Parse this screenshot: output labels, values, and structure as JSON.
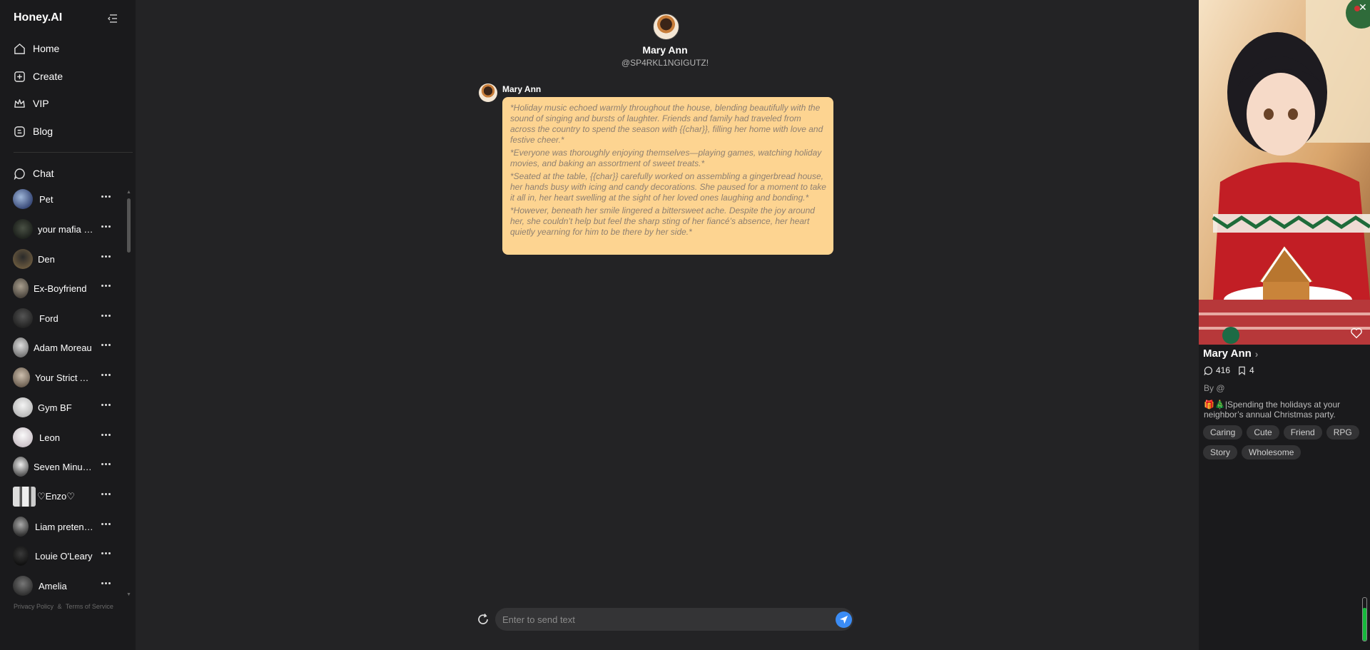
{
  "app": {
    "brand": "Honey.AI"
  },
  "nav": [
    {
      "label": "Home",
      "icon": "home-icon"
    },
    {
      "label": "Create",
      "icon": "plus-square-icon"
    },
    {
      "label": "VIP",
      "icon": "crown-icon"
    },
    {
      "label": "Blog",
      "icon": "blog-icon"
    }
  ],
  "chat_section": {
    "label": "Chat"
  },
  "chats": [
    {
      "name": "Pet"
    },
    {
      "name": "your mafia husband"
    },
    {
      "name": "Den"
    },
    {
      "name": "Ex-Boyfriend"
    },
    {
      "name": "Ford"
    },
    {
      "name": "Adam Moreau"
    },
    {
      "name": "Your Strict Assistant"
    },
    {
      "name": "Gym BF"
    },
    {
      "name": "Leon"
    },
    {
      "name": "Seven Minutes"
    },
    {
      "name": "♡Enzo♡"
    },
    {
      "name": "Liam pretending"
    },
    {
      "name": "Louie O'Leary"
    },
    {
      "name": "Amelia"
    }
  ],
  "footer": {
    "privacy": "Privacy Policy",
    "amp": "&",
    "terms": "Terms of Service"
  },
  "conversation": {
    "character_name": "Mary Ann",
    "character_handle": "@SP4RKL1NGIGUTZ!",
    "messages": [
      {
        "sender": "Mary Ann",
        "paragraphs": [
          "*Holiday music echoed warmly throughout the house, blending beautifully with the sound of singing and bursts of laughter. Friends and family had traveled from across the country to spend the season with {{char}}, filling her home with love and festive cheer.*",
          "*Everyone was thoroughly enjoying themselves—playing games, watching holiday movies, and baking an assortment of sweet treats.*",
          "*Seated at the table, {{char}} carefully worked on assembling a gingerbread house, her hands busy with icing and candy decorations. She paused for a moment to take it all in, her heart swelling at the sight of her loved ones laughing and bonding.*",
          "*However, beneath her smile lingered a bittersweet ache. Despite the joy around her, she couldn’t help but feel the sharp sting of her fiancé’s absence, her heart quietly yearning for him to be there by her side.*"
        ]
      }
    ]
  },
  "composer": {
    "placeholder": "Enter to send text"
  },
  "profile": {
    "name": "Mary Ann",
    "chats_count": "416",
    "bookmarks_count": "4",
    "by": "By @",
    "description": "🎁🎄|Spending the holidays at your neighbor’s annual Christmas party.",
    "tags": [
      "Caring",
      "Cute",
      "Friend",
      "RPG",
      "Story",
      "Wholesome"
    ]
  },
  "colors": {
    "accent": "#3b8cf5",
    "bubble": "#fdd491",
    "bg": "#232325",
    "sidebar": "#1a1a1c"
  }
}
